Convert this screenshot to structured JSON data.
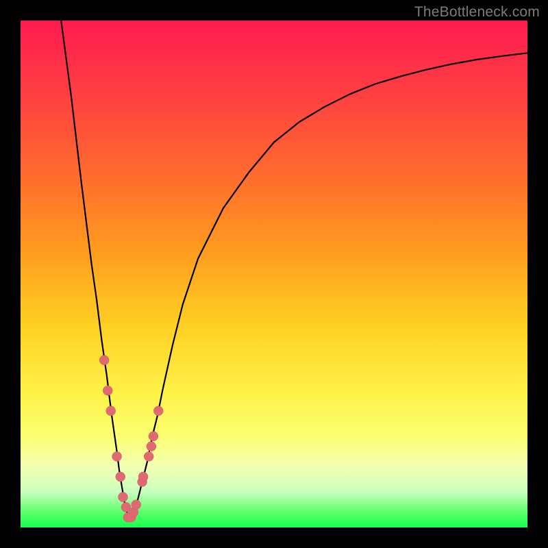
{
  "watermark": "TheBottleneck.com",
  "chart_data": {
    "type": "line",
    "title": "",
    "xlabel": "",
    "ylabel": "",
    "xlim": [
      0,
      100
    ],
    "ylim": [
      0,
      100
    ],
    "x": [
      8,
      10,
      12,
      14,
      15,
      16,
      17,
      18,
      19,
      19.5,
      20,
      20.5,
      21,
      21.5,
      22,
      22.5,
      23,
      24,
      25,
      26,
      27,
      28,
      30,
      32,
      35,
      40,
      45,
      50,
      55,
      60,
      65,
      70,
      75,
      80,
      85,
      90,
      95,
      100
    ],
    "y": [
      100,
      85,
      68,
      52,
      45,
      37,
      30,
      22,
      15,
      11,
      8,
      5,
      3,
      2,
      2,
      3,
      5,
      9,
      13,
      18,
      22,
      27,
      36,
      44,
      53,
      63,
      70,
      76,
      80,
      83,
      85.5,
      87.5,
      89,
      90.3,
      91.4,
      92.3,
      93,
      93.6
    ],
    "markers": {
      "x": [
        16.5,
        17.2,
        17.8,
        19.0,
        19.7,
        20.2,
        20.8,
        21.2,
        21.8,
        22.3,
        22.8,
        24.0,
        24.2,
        25.3,
        25.8,
        26.2,
        27.2
      ],
      "y": [
        33,
        27,
        23,
        14,
        10,
        6,
        4,
        2,
        2,
        3,
        4.5,
        9,
        10,
        14,
        16,
        18,
        23
      ]
    },
    "annotations": []
  }
}
